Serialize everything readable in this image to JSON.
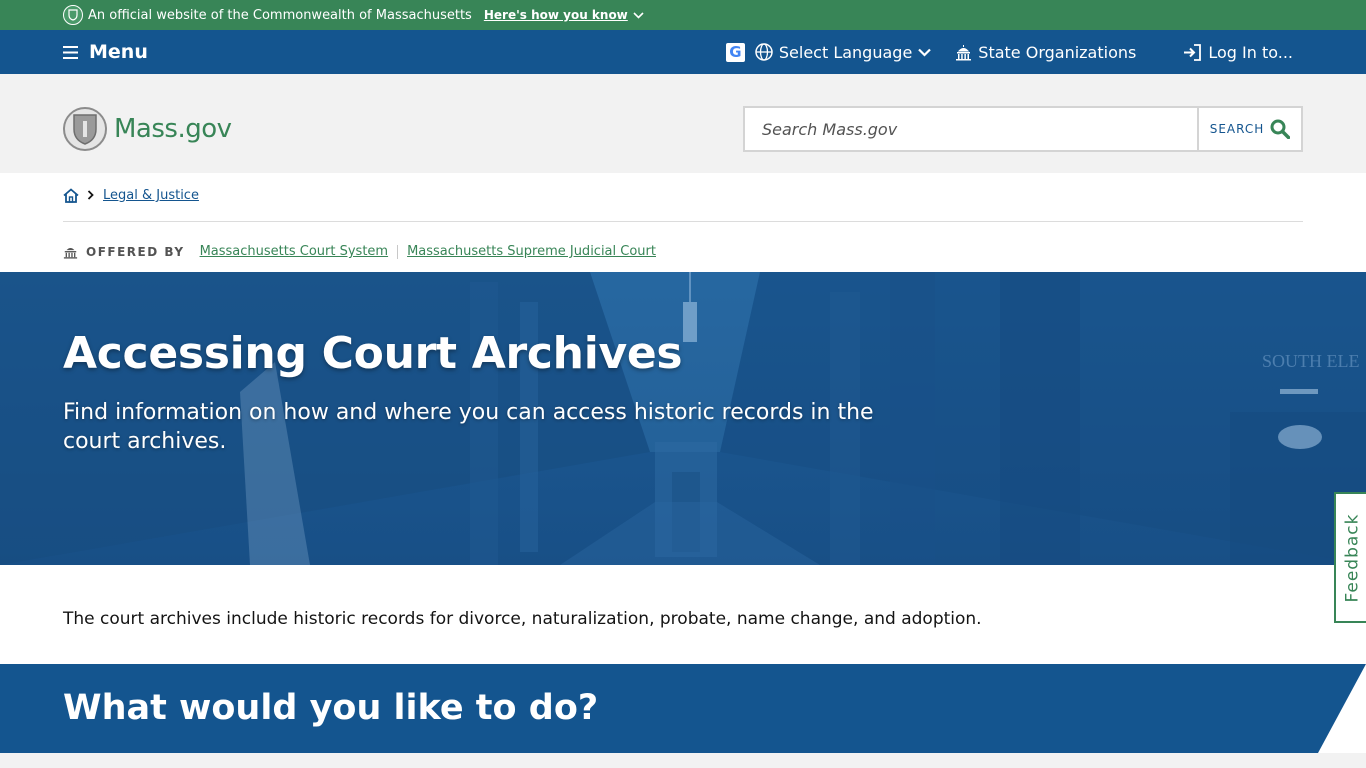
{
  "official_banner": {
    "text": "An official website of the Commonwealth of Massachusetts",
    "link": "Here's how you know"
  },
  "utility_nav": {
    "menu_label": "Menu",
    "language_label": "Select Language",
    "state_orgs_label": "State Organizations",
    "login_label": "Log In to..."
  },
  "header": {
    "logo_text": "Mass.gov",
    "search_placeholder": "Search Mass.gov",
    "search_button": "SEARCH"
  },
  "breadcrumb": {
    "items": [
      {
        "label": "Legal & Justice"
      }
    ]
  },
  "offered_by": {
    "label": "OFFERED BY",
    "orgs": [
      "Massachusetts Court System",
      "Massachusetts Supreme Judicial Court"
    ]
  },
  "hero": {
    "title": "Accessing Court Archives",
    "subtitle": "Find information on how and where you can access historic records in the court archives.",
    "bg_sign": "SOUTH ELE"
  },
  "intro": {
    "text": "The court archives include historic records for divorce, naturalization, probate, name change, and adoption."
  },
  "section": {
    "heading": "What would you like to do?"
  },
  "feedback": {
    "label": "Feedback"
  },
  "colors": {
    "primary_blue": "#14558f",
    "brand_green": "#388557",
    "header_gray": "#f2f2f2"
  }
}
